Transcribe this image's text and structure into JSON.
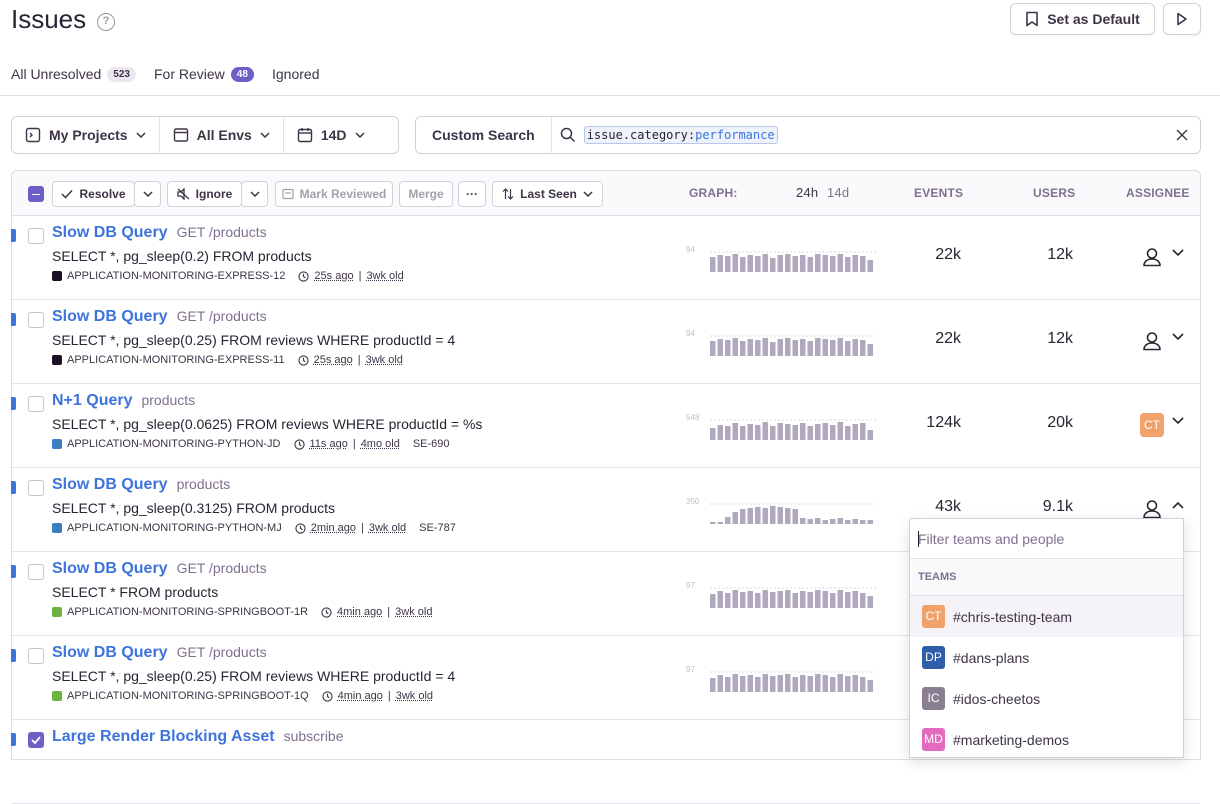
{
  "header": {
    "title": "Issues",
    "help": "?",
    "set_default": "Set as Default"
  },
  "tabs": [
    {
      "label": "All Unresolved",
      "count": "523"
    },
    {
      "label": "For Review",
      "count": "48"
    },
    {
      "label": "Ignored"
    }
  ],
  "filters": {
    "projects": "My Projects",
    "envs": "All Envs",
    "period": "14D"
  },
  "search": {
    "custom": "Custom Search",
    "key": "issue.category",
    "sep": ":",
    "value": "performance"
  },
  "toolbar": {
    "resolve": "Resolve",
    "ignore": "Ignore",
    "mark_reviewed": "Mark Reviewed",
    "merge": "Merge",
    "more": "···",
    "sort": "Last Seen",
    "graph": "GRAPH:",
    "g24": "24h",
    "g14": "14d",
    "events": "EVENTS",
    "users": "USERS",
    "assignee": "ASSIGNEE"
  },
  "issues": [
    {
      "title": "Slow DB Query",
      "sub": "GET /products",
      "msg": "SELECT *, pg_sleep(0.2) FROM products",
      "project": "APPLICATION-MONITORING-EXPRESS-12",
      "project_color": "#1d1127",
      "seen": "25s ago",
      "age": "3wk old",
      "short": "",
      "graph_max": "94",
      "events": "22k",
      "users": "12k",
      "assignee": "",
      "checked": false
    },
    {
      "title": "Slow DB Query",
      "sub": "GET /products",
      "msg": "SELECT *, pg_sleep(0.25) FROM reviews WHERE productId = 4",
      "project": "APPLICATION-MONITORING-EXPRESS-11",
      "project_color": "#1d1127",
      "seen": "25s ago",
      "age": "3wk old",
      "short": "",
      "graph_max": "94",
      "events": "22k",
      "users": "12k",
      "assignee": "",
      "checked": false
    },
    {
      "title": "N+1 Query",
      "sub": "products",
      "msg": "SELECT *, pg_sleep(0.0625) FROM reviews WHERE productId = %s",
      "project": "APPLICATION-MONITORING-PYTHON-JD",
      "project_color": "#3c7fc1",
      "seen": "11s ago",
      "age": "4mo old",
      "short": "SE-690",
      "graph_max": "548",
      "events": "124k",
      "users": "20k",
      "assignee": "CT",
      "checked": false
    },
    {
      "title": "Slow DB Query",
      "sub": "products",
      "msg": "SELECT *, pg_sleep(0.3125) FROM products",
      "project": "APPLICATION-MONITORING-PYTHON-MJ",
      "project_color": "#3c7fc1",
      "seen": "2min ago",
      "age": "3wk old",
      "short": "SE-787",
      "graph_max": "350",
      "events": "43k",
      "users": "9.1k",
      "assignee": "",
      "checked": false
    },
    {
      "title": "Slow DB Query",
      "sub": "GET /products",
      "msg": "SELECT * FROM products",
      "project": "APPLICATION-MONITORING-SPRINGBOOT-1R",
      "project_color": "#6db33f",
      "seen": "4min ago",
      "age": "3wk old",
      "short": "",
      "graph_max": "97",
      "events": "",
      "users": "",
      "assignee": "",
      "checked": false
    },
    {
      "title": "Slow DB Query",
      "sub": "GET /products",
      "msg": "SELECT *, pg_sleep(0.25) FROM reviews WHERE productId = 4",
      "project": "APPLICATION-MONITORING-SPRINGBOOT-1Q",
      "project_color": "#6db33f",
      "seen": "4min ago",
      "age": "3wk old",
      "short": "",
      "graph_max": "97",
      "events": "",
      "users": "",
      "assignee": "",
      "checked": false
    },
    {
      "title": "Large Render Blocking Asset",
      "sub": "subscribe",
      "msg": "",
      "project": "",
      "seen": "",
      "age": "",
      "short": "",
      "graph_max": "",
      "events": "",
      "users": "",
      "assignee": "",
      "checked": true
    }
  ],
  "assignee_dropdown": {
    "placeholder": "Filter teams and people",
    "section": "TEAMS",
    "teams": [
      {
        "initials": "CT",
        "name": "#chris-testing-team",
        "color": "#f0a26a"
      },
      {
        "initials": "DP",
        "name": "#dans-plans",
        "color": "#2f5ea8"
      },
      {
        "initials": "IC",
        "name": "#idos-cheetos",
        "color": "#8a7f90"
      },
      {
        "initials": "MD",
        "name": "#marketing-demos",
        "color": "#e26bc0"
      }
    ]
  },
  "colors": {
    "accent": "#6c5fc7",
    "link": "#3d74db",
    "ct": "#f0a26a"
  }
}
